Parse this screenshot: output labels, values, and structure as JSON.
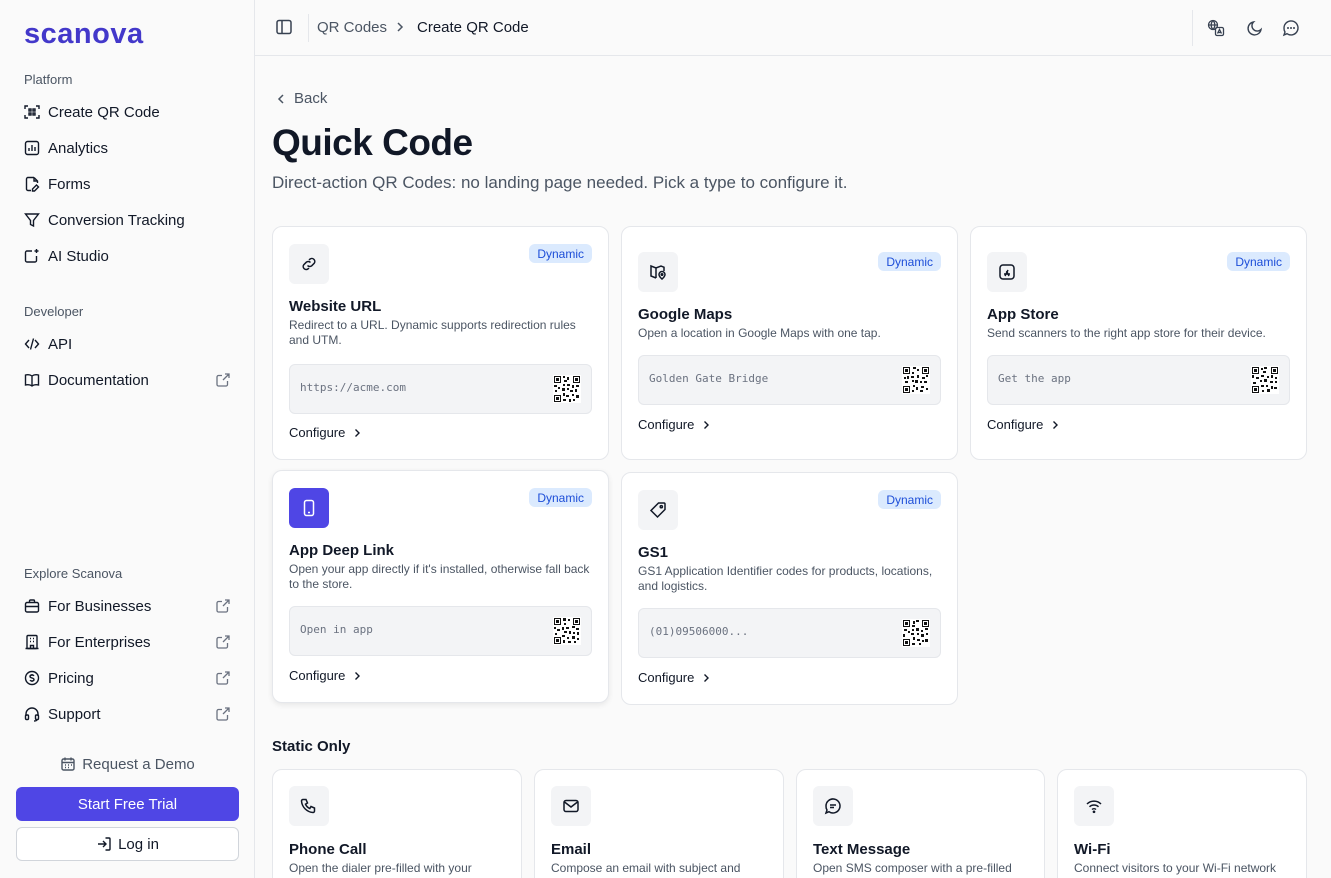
{
  "brand": {
    "logo": "scanova",
    "accent": "#4f46e5"
  },
  "sidebar": {
    "platform_title": "Platform",
    "platform_items": [
      {
        "label": "Create QR Code",
        "icon": "qr-scan-icon"
      },
      {
        "label": "Analytics",
        "icon": "bar-chart-icon"
      },
      {
        "label": "Forms",
        "icon": "form-icon"
      },
      {
        "label": "Conversion Tracking",
        "icon": "funnel-icon"
      },
      {
        "label": "AI Studio",
        "icon": "sparkle-icon"
      }
    ],
    "developer_title": "Developer",
    "developer_items": [
      {
        "label": "API",
        "icon": "code-icon"
      },
      {
        "label": "Documentation",
        "icon": "book-icon",
        "external": true
      }
    ],
    "explore_title": "Explore Scanova",
    "explore_items": [
      {
        "label": "For Businesses",
        "icon": "briefcase-icon",
        "external": true
      },
      {
        "label": "For Enterprises",
        "icon": "building-icon",
        "external": true
      },
      {
        "label": "Pricing",
        "icon": "dollar-icon",
        "external": true
      },
      {
        "label": "Support",
        "icon": "headset-icon",
        "external": true
      }
    ],
    "demo_label": "Request a Demo",
    "trial_label": "Start Free Trial",
    "login_label": "Log in"
  },
  "topbar": {
    "breadcrumb": [
      "QR Codes",
      "Create QR Code"
    ]
  },
  "main": {
    "back_label": "Back",
    "title": "Quick Code",
    "subtitle": "Direct-action QR Codes: no landing page needed. Pick a type to configure it.",
    "dynamic_cards": [
      {
        "title": "Website URL",
        "desc": "Redirect to a URL. Dynamic supports redirection rules and UTM.",
        "badge": "Dynamic",
        "preview": "https://acme.com",
        "configure": "Configure",
        "icon": "link-icon"
      },
      {
        "title": "Google Maps",
        "desc": "Open a location in Google Maps with one tap.",
        "badge": "Dynamic",
        "preview": "Golden Gate Bridge",
        "configure": "Configure",
        "icon": "map-pin-icon"
      },
      {
        "title": "App Store",
        "desc": "Send scanners to the right app store for their device.",
        "badge": "Dynamic",
        "preview": "Get the app",
        "configure": "Configure",
        "icon": "app-store-icon"
      },
      {
        "title": "App Deep Link",
        "desc": "Open your app directly if it's installed, otherwise fall back to the store.",
        "badge": "Dynamic",
        "preview": "Open in app",
        "configure": "Configure",
        "icon": "smartphone-icon"
      },
      {
        "title": "GS1",
        "desc": "GS1 Application Identifier codes for products, locations, and logistics.",
        "badge": "Dynamic",
        "preview": "(01)09506000...",
        "configure": "Configure",
        "icon": "tag-icon"
      }
    ],
    "static_title": "Static Only",
    "static_cards": [
      {
        "title": "Phone Call",
        "desc": "Open the dialer pre-filled with your",
        "icon": "phone-icon"
      },
      {
        "title": "Email",
        "desc": "Compose an email with subject and",
        "icon": "mail-icon"
      },
      {
        "title": "Text Message",
        "desc": "Open SMS composer with a pre-filled",
        "icon": "message-icon"
      },
      {
        "title": "Wi-Fi",
        "desc": "Connect visitors to your Wi-Fi network",
        "icon": "wifi-icon"
      }
    ]
  }
}
